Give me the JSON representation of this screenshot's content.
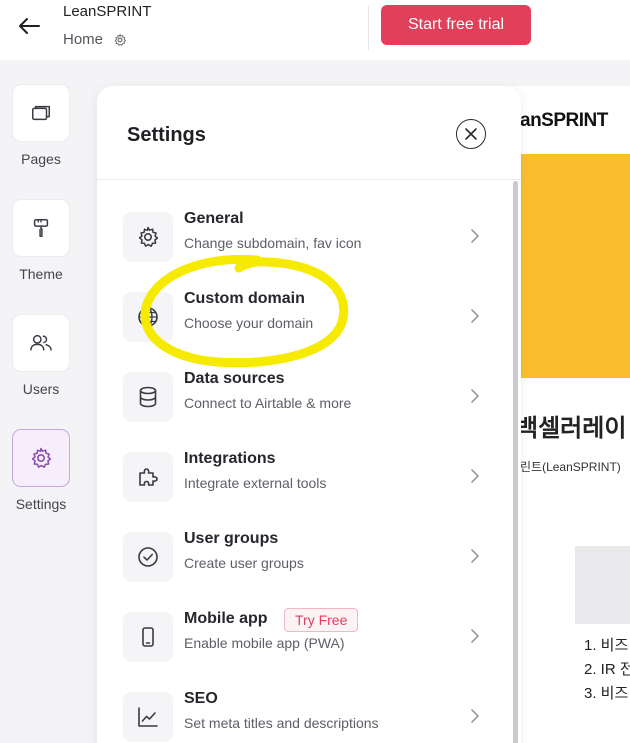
{
  "header": {
    "app_name": "LeanSPRINT",
    "breadcrumb": "Home",
    "trial_button": "Start free trial",
    "colors": {
      "trial_button": "#e0405a"
    }
  },
  "sidebar": {
    "items": [
      {
        "label": "Pages",
        "icon": "pages-icon"
      },
      {
        "label": "Theme",
        "icon": "paint-roller-icon"
      },
      {
        "label": "Users",
        "icon": "users-icon"
      },
      {
        "label": "Settings",
        "icon": "gear-icon",
        "active": true
      }
    ]
  },
  "settings": {
    "title": "Settings",
    "items": [
      {
        "title": "General",
        "description": "Change subdomain, fav icon",
        "icon": "gear-icon"
      },
      {
        "title": "Custom domain",
        "description": "Choose your domain",
        "icon": "globe-icon"
      },
      {
        "title": "Data sources",
        "description": "Connect to Airtable & more",
        "icon": "database-icon"
      },
      {
        "title": "Integrations",
        "description": "Integrate external tools",
        "icon": "puzzle-icon"
      },
      {
        "title": "User groups",
        "description": "Create user groups",
        "icon": "check-circle-icon"
      },
      {
        "title": "Mobile app",
        "description": "Enable mobile app (PWA)",
        "icon": "phone-icon",
        "badge": "Try Free"
      },
      {
        "title": "SEO",
        "description": "Set meta titles and descriptions",
        "icon": "trend-chart-icon"
      }
    ]
  },
  "preview": {
    "logo": "anSPRINT",
    "heading": "백셀러레이",
    "subtext": "린트(LeanSPRINT)",
    "list": [
      "1. 비즈",
      "2. IR 전",
      "3. 비즈"
    ],
    "colors": {
      "banner": "#fbbf2e"
    }
  },
  "annotation": {
    "highlight_color": "#f6ea00"
  }
}
